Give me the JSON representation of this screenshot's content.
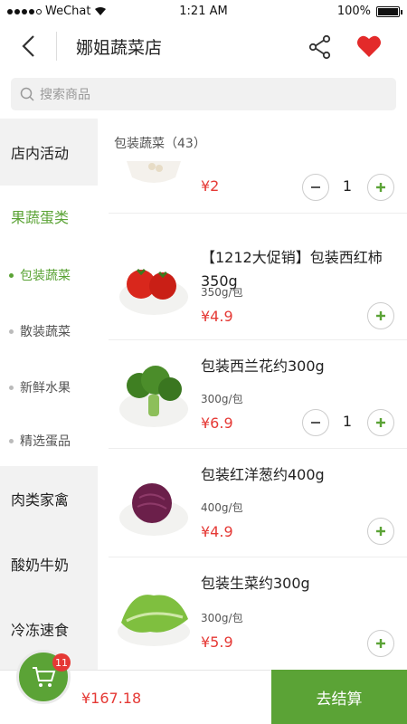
{
  "status_bar": {
    "carrier": "WeChat",
    "time": "1:21 AM",
    "battery": "100%"
  },
  "nav": {
    "title": "娜姐蔬菜店"
  },
  "search": {
    "placeholder": "搜索商品"
  },
  "sidebar": {
    "items": [
      {
        "label": "店内活动"
      },
      {
        "label": "果蔬蛋类"
      },
      {
        "label": "肉类家禽"
      },
      {
        "label": "酸奶牛奶"
      },
      {
        "label": "冷冻速食"
      }
    ],
    "subitems": [
      {
        "label": "包装蔬菜"
      },
      {
        "label": "散装蔬菜"
      },
      {
        "label": "新鲜水果"
      },
      {
        "label": "精选蛋品"
      }
    ]
  },
  "category": {
    "header": "包装蔬菜（43）"
  },
  "products": [
    {
      "name": "",
      "spec": "",
      "price": "¥2",
      "qty": "1"
    },
    {
      "name": "【1212大促销】包装西红柿350g",
      "spec": "350g/包",
      "price": "¥4.9"
    },
    {
      "name": "包装西兰花约300g",
      "spec": "300g/包",
      "price": "¥6.9",
      "qty": "1"
    },
    {
      "name": "包装红洋葱约400g",
      "spec": "400g/包",
      "price": "¥4.9"
    },
    {
      "name": "包装生菜约300g",
      "spec": "300g/包",
      "price": "¥5.9"
    }
  ],
  "cart": {
    "badge": "11",
    "total": "¥167.18",
    "checkout_label": "去结算"
  },
  "colors": {
    "accent": "#5ba336",
    "price": "#e53935",
    "sidebar_bg": "#f2f2f2"
  }
}
